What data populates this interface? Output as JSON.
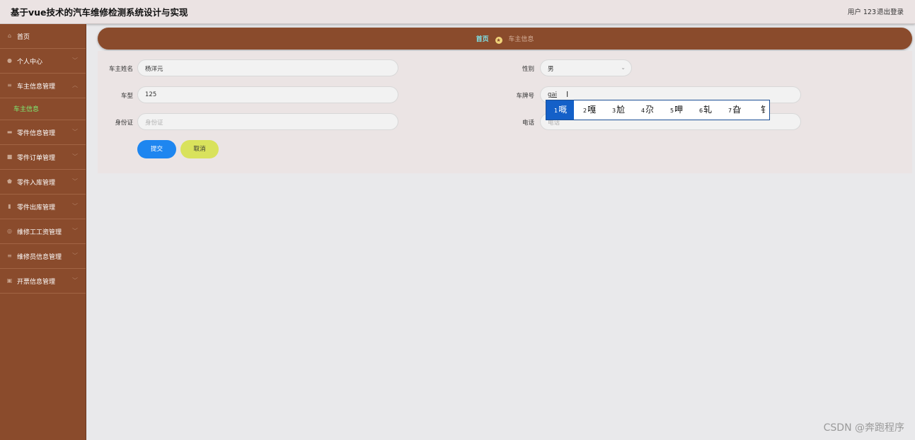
{
  "app": {
    "title": "基于vue技术的汽车维修检测系统设计与实现",
    "user_label": "用户 123",
    "logout_label": "退出登录"
  },
  "sidebar": {
    "items": [
      {
        "label": "首页",
        "icon": "home-icon",
        "arrow": ""
      },
      {
        "label": "个人中心",
        "icon": "user-icon",
        "arrow": "﹀"
      },
      {
        "label": "车主信息管理",
        "icon": "list-icon",
        "arrow": "︿"
      },
      {
        "label": "零件信息管理",
        "icon": "car-icon",
        "arrow": "﹀"
      },
      {
        "label": "零件订单管理",
        "icon": "order-icon",
        "arrow": "﹀"
      },
      {
        "label": "零件入库管理",
        "icon": "shield-icon",
        "arrow": "﹀"
      },
      {
        "label": "零件出库管理",
        "icon": "clipboard-icon",
        "arrow": "﹀"
      },
      {
        "label": "维修工工资管理",
        "icon": "wage-icon",
        "arrow": "﹀"
      },
      {
        "label": "维修员信息管理",
        "icon": "list-icon",
        "arrow": "﹀"
      },
      {
        "label": "开票信息管理",
        "icon": "invoice-icon",
        "arrow": "﹀"
      }
    ],
    "active_sub": "车主信息"
  },
  "breadcrumb": {
    "home": "首页",
    "current": "车主信息"
  },
  "form": {
    "owner_name_label": "车主姓名",
    "owner_name_value": "杨洋元",
    "gender_label": "性别",
    "gender_value": "男",
    "car_model_label": "车型",
    "car_model_value": "125",
    "plate_label": "车牌号",
    "plate_value": "gai",
    "id_card_label": "身份证",
    "id_card_placeholder": "身份证",
    "phone_label": "电话",
    "phone_placeholder": "电话",
    "submit_label": "提交",
    "cancel_label": "取消"
  },
  "ime": {
    "candidates": [
      {
        "n": "1",
        "ch": "嘅"
      },
      {
        "n": "2",
        "ch": "嘎"
      },
      {
        "n": "3",
        "ch": "尬"
      },
      {
        "n": "4",
        "ch": "尕"
      },
      {
        "n": "5",
        "ch": "呷"
      },
      {
        "n": "6",
        "ch": "轧"
      },
      {
        "n": "7",
        "ch": "旮"
      },
      {
        "n": "",
        "ch": "钅"
      }
    ]
  },
  "watermark": "CSDN @奔跑程序"
}
